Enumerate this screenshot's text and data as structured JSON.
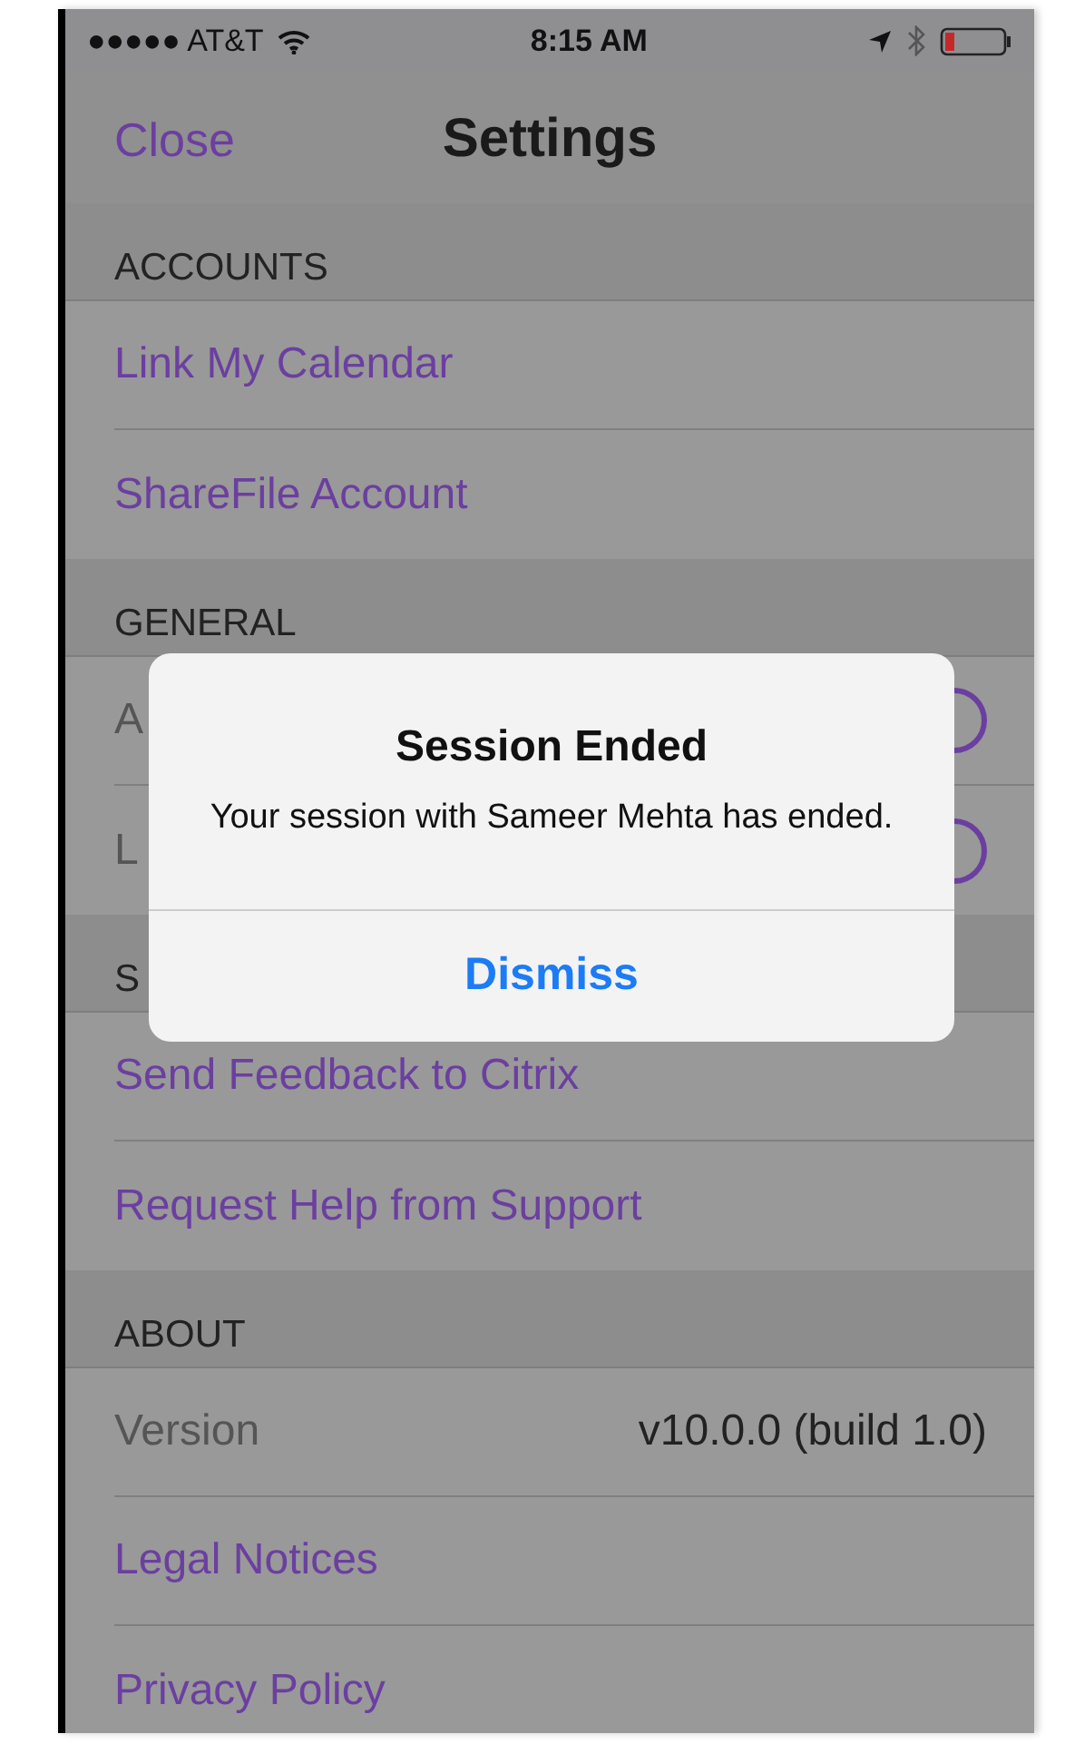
{
  "status_bar": {
    "carrier": "●●●●● AT&T",
    "time": "8:15 AM"
  },
  "nav": {
    "left": "Close",
    "title": "Settings"
  },
  "sections": [
    {
      "header": "ACCOUNTS",
      "rows": [
        {
          "kind": "link",
          "label": "Link My Calendar"
        },
        {
          "kind": "link",
          "label": "ShareFile Account"
        }
      ]
    },
    {
      "header": "GENERAL",
      "rows": [
        {
          "kind": "toggle",
          "label": "A",
          "on": false
        },
        {
          "kind": "toggle",
          "label": "L",
          "on": false
        }
      ]
    },
    {
      "header": "S",
      "rows": [
        {
          "kind": "link",
          "label": "Send Feedback to Citrix"
        },
        {
          "kind": "link",
          "label": "Request Help from Support"
        }
      ]
    },
    {
      "header": "ABOUT",
      "rows": [
        {
          "kind": "value",
          "label": "Version",
          "value": "v10.0.0 (build 1.0)"
        },
        {
          "kind": "link",
          "label": "Legal Notices"
        },
        {
          "kind": "link",
          "label": "Privacy Policy"
        }
      ]
    }
  ],
  "alert": {
    "title": "Session Ended",
    "message": "Your session with Sameer Mehta has ended.",
    "button": "Dismiss"
  }
}
